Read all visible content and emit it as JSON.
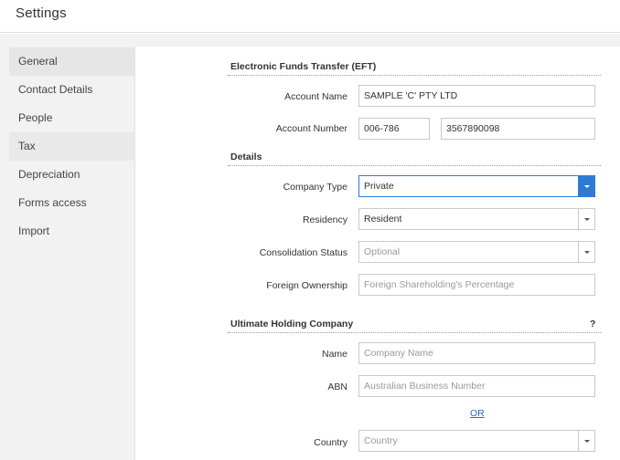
{
  "header": {
    "title": "Settings"
  },
  "sidebar": {
    "items": [
      {
        "label": "General"
      },
      {
        "label": "Contact Details"
      },
      {
        "label": "People"
      },
      {
        "label": "Tax"
      },
      {
        "label": "Depreciation"
      },
      {
        "label": "Forms access"
      },
      {
        "label": "Import"
      }
    ]
  },
  "eft": {
    "title": "Electronic Funds Transfer (EFT)",
    "account_name_label": "Account Name",
    "account_name_value": "SAMPLE 'C' PTY LTD",
    "account_number_label": "Account Number",
    "bsb_value": "006-786",
    "account_number_value": "3567890098"
  },
  "details": {
    "title": "Details",
    "company_type_label": "Company Type",
    "company_type_value": "Private",
    "residency_label": "Residency",
    "residency_value": "Resident",
    "consolidation_label": "Consolidation Status",
    "consolidation_placeholder": "Optional",
    "foreign_label": "Foreign Ownership",
    "foreign_placeholder": "Foreign Shareholding's Percentage"
  },
  "ultimate": {
    "title": "Ultimate Holding Company",
    "help": "?",
    "name_label": "Name",
    "name_placeholder": "Company Name",
    "abn_label": "ABN",
    "abn_placeholder": "Australian Business Number",
    "or_label": "OR",
    "country_label": "Country",
    "country_placeholder": "Country"
  }
}
